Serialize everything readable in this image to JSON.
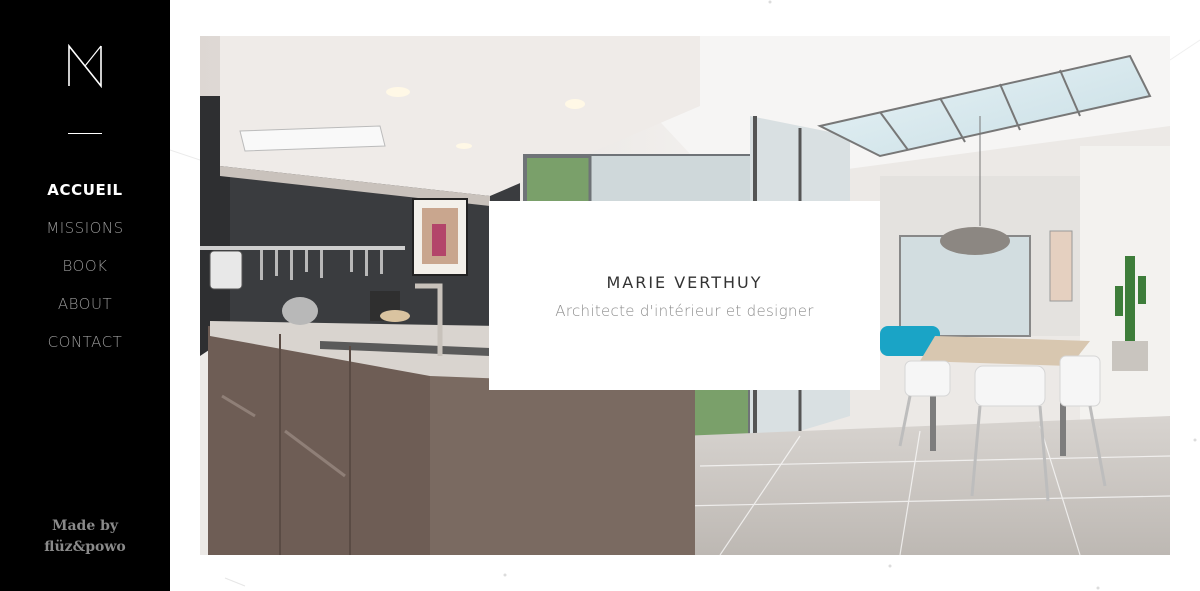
{
  "nav": {
    "items": [
      {
        "label": "ACCUEIL",
        "active": true
      },
      {
        "label": "MISSIONS",
        "active": false
      },
      {
        "label": "BOOK",
        "active": false
      },
      {
        "label": "ABOUT",
        "active": false
      },
      {
        "label": "CONTACT",
        "active": false
      }
    ]
  },
  "credit": {
    "line1": "Made by",
    "line2": "flüz&powo"
  },
  "hero": {
    "name": "MARIE VERTHUY",
    "subtitle": "Architecte d'intérieur et designer"
  },
  "colors": {
    "sidebar_bg": "#000000",
    "nav_active": "#ffffff",
    "nav_inactive": "#9a9a9a",
    "card_bg": "#ffffff"
  },
  "icons": {
    "logo": "monogram-m-logo"
  }
}
